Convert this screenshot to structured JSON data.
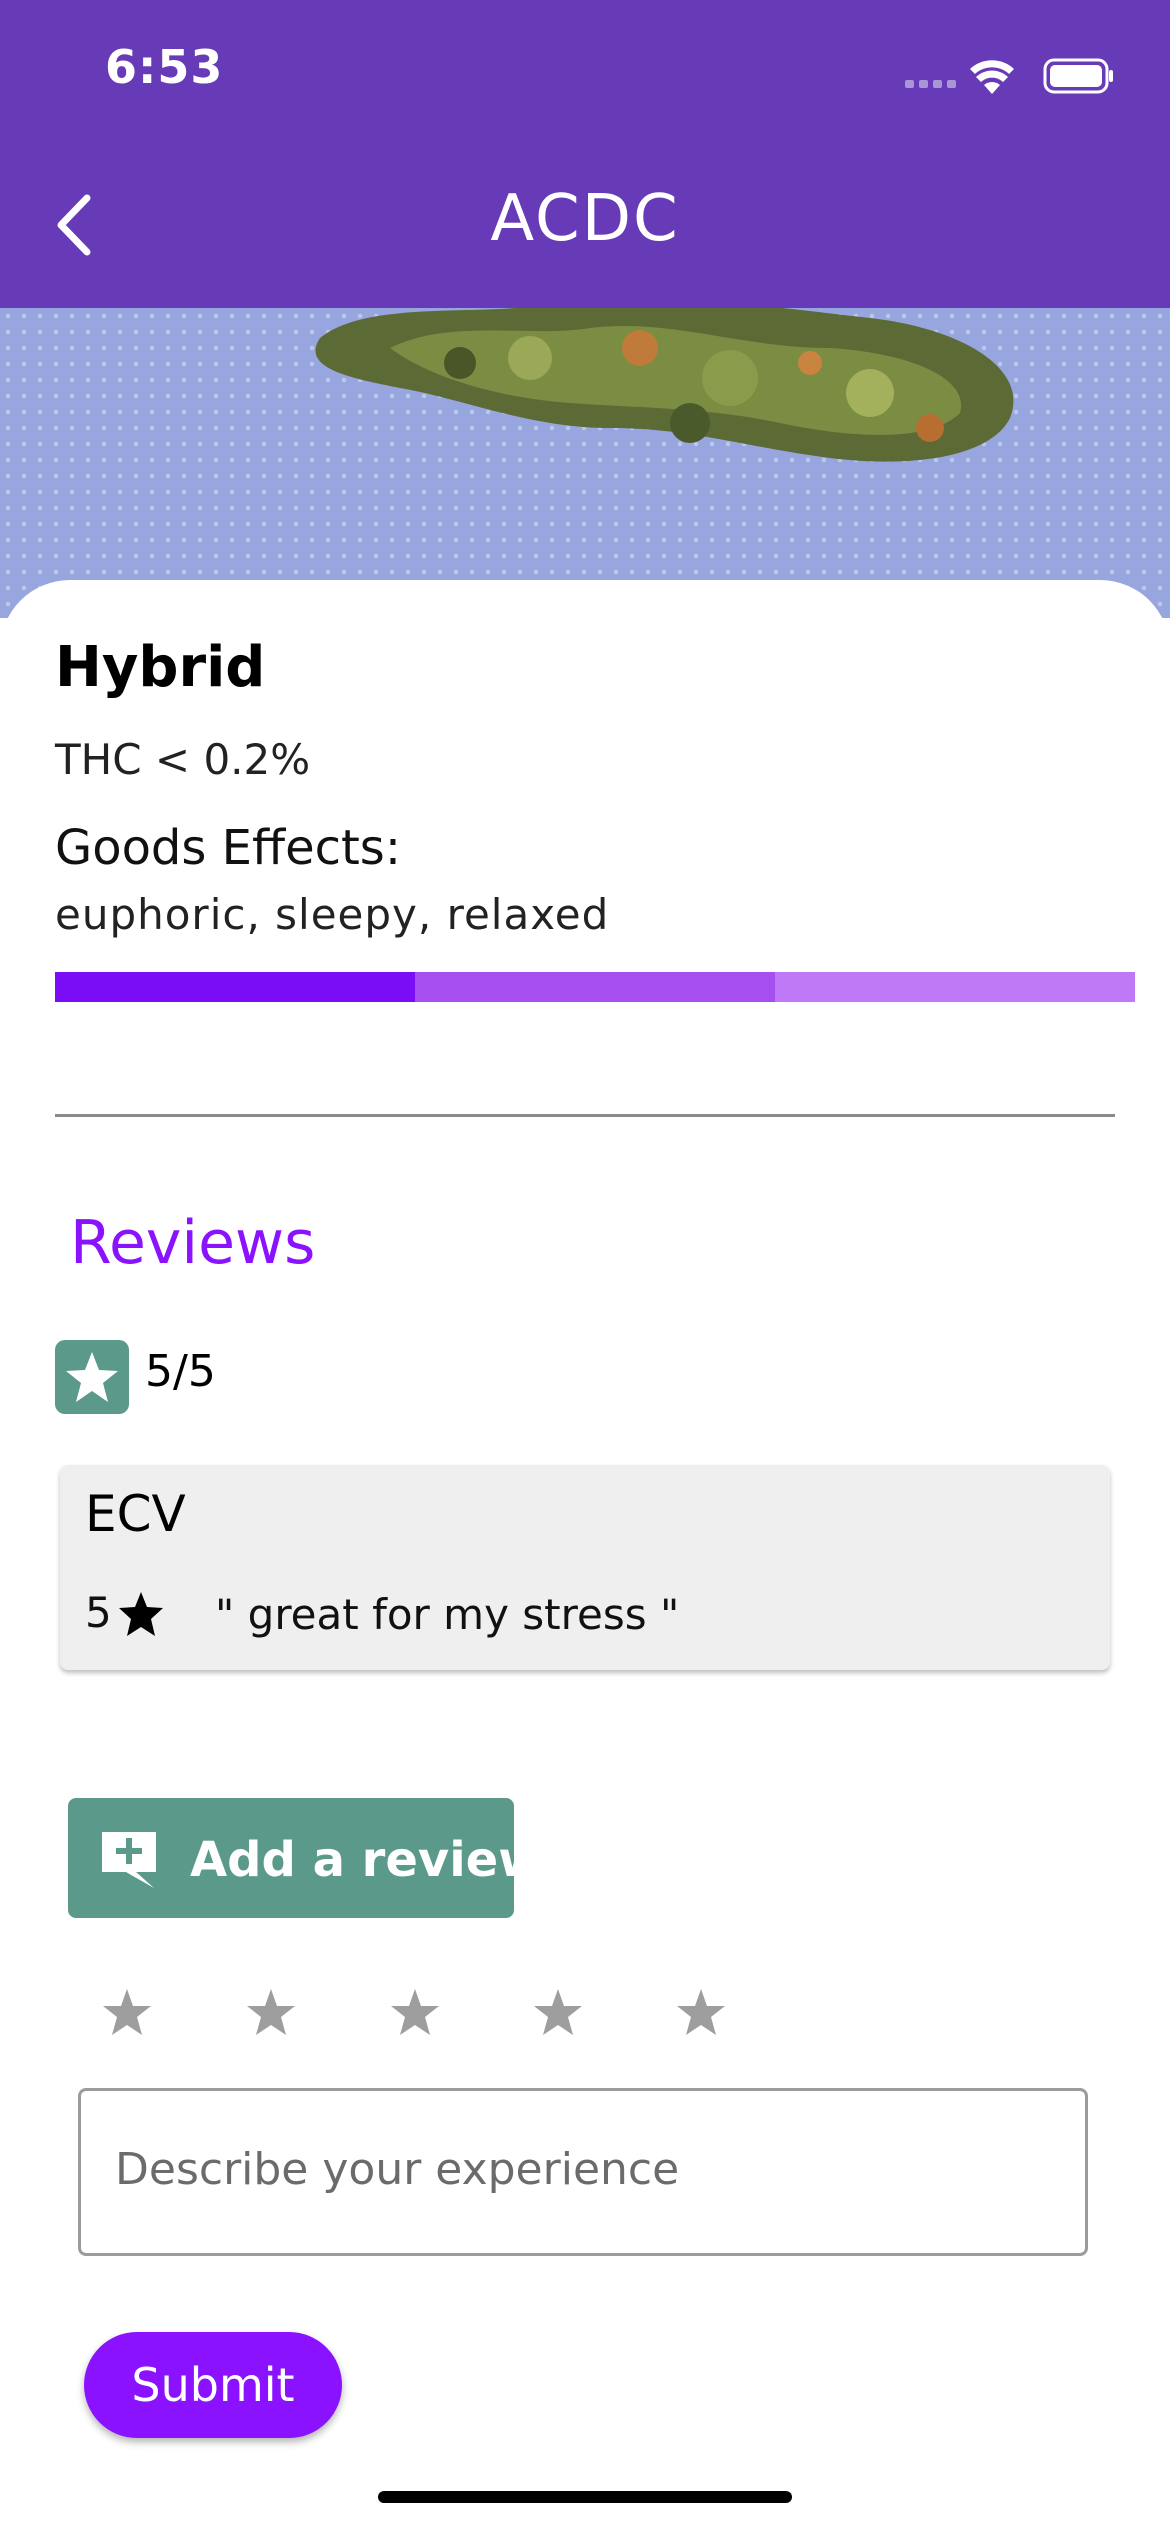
{
  "status_bar": {
    "time": "6:53"
  },
  "header": {
    "title": "ACDC"
  },
  "strain": {
    "type": "Hybrid",
    "thc": "THC < 0.2%",
    "effects_label": "Goods Effects:",
    "effects": "euphoric, sleepy, relaxed",
    "effects_bar_colors": [
      "#7a0df5",
      "#a64ef0",
      "#bf79f7"
    ]
  },
  "reviews": {
    "title": "Reviews",
    "average": "5/5",
    "items": [
      {
        "user": "ECV",
        "rating": "5",
        "text": "\" great for my stress \""
      }
    ]
  },
  "add_review": {
    "button_label": "Add a review",
    "placeholder": "Describe your experience",
    "submit_label": "Submit"
  },
  "colors": {
    "header": "#673ab7",
    "accent_purple": "#8a12ff",
    "teal": "#5b9a8b"
  }
}
